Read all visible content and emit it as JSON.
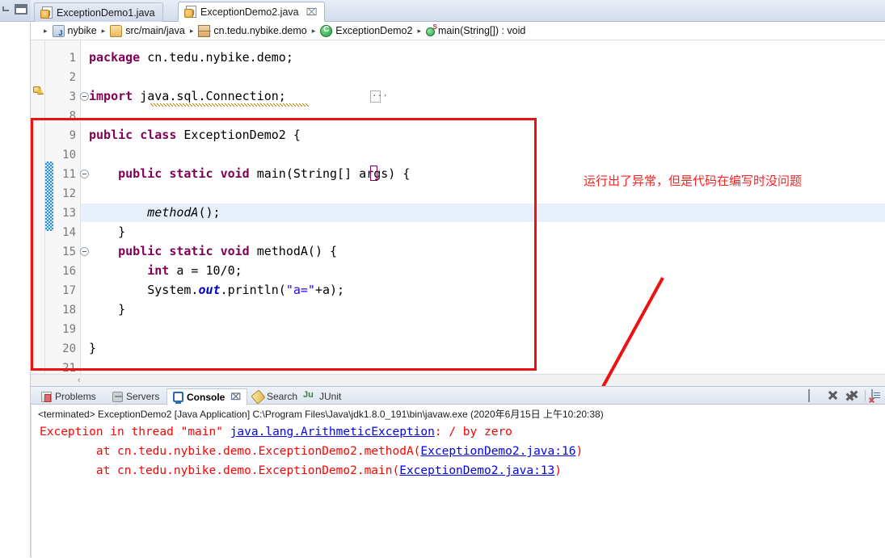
{
  "window": {
    "rail": {
      "minimize_icon": "minimize-icon",
      "restore_icon": "restore-icon"
    }
  },
  "editor": {
    "tabs": [
      {
        "label": "ExceptionDemo1.java",
        "active": false,
        "icon": "java-file-icon"
      },
      {
        "label": "ExceptionDemo2.java",
        "active": true,
        "icon": "java-file-icon",
        "close": "⌧"
      }
    ],
    "breadcrumb": [
      {
        "label": "nybike",
        "icon": "project-icon"
      },
      {
        "label": "src/main/java",
        "icon": "source-folder-icon"
      },
      {
        "label": "cn.tedu.nybike.demo",
        "icon": "package-icon"
      },
      {
        "label": "ExceptionDemo2",
        "icon": "class-icon"
      },
      {
        "label": "main(String[]) : void",
        "icon": "method-icon"
      }
    ],
    "separator": "▸",
    "lines": [
      {
        "num": "1",
        "code": "package cn.tedu.nybike.demo;"
      },
      {
        "num": "2",
        "code": ""
      },
      {
        "num": "3",
        "code": "import java.sql.Connection;"
      },
      {
        "num": "8",
        "code": ""
      },
      {
        "num": "9",
        "code": "public class ExceptionDemo2 {"
      },
      {
        "num": "10",
        "code": ""
      },
      {
        "num": "11",
        "code": "    public static void main(String[] args) {"
      },
      {
        "num": "12",
        "code": ""
      },
      {
        "num": "13",
        "code": "        methodA();"
      },
      {
        "num": "14",
        "code": "    }"
      },
      {
        "num": "15",
        "code": "    public static void methodA() {"
      },
      {
        "num": "16",
        "code": "        int a = 10/0;"
      },
      {
        "num": "17",
        "code": "        System.out.println(\"a=\"+a);"
      },
      {
        "num": "18",
        "code": "    }"
      },
      {
        "num": "19",
        "code": ""
      },
      {
        "num": "20",
        "code": "}"
      },
      {
        "num": "21",
        "code": ""
      }
    ],
    "hscroll_arrow": "‹"
  },
  "annotation": {
    "note": "运行出了异常，但是代码在编写时没问题",
    "note_color": "#ff2222",
    "box_color": "#ee1111",
    "arrow_color": "#ee1111"
  },
  "console": {
    "tabs": [
      {
        "label": "Problems",
        "icon": "problems-icon",
        "selected": false
      },
      {
        "label": "Servers",
        "icon": "servers-icon",
        "selected": false
      },
      {
        "label": "Console",
        "icon": "console-icon",
        "selected": true,
        "close": "⌧"
      },
      {
        "label": "Search",
        "icon": "search-icon",
        "selected": false
      },
      {
        "label": "JUnit",
        "icon": "junit-icon",
        "selected": false
      }
    ],
    "toolbar": [
      {
        "name": "stop-button",
        "icon": "stop-square-icon"
      },
      {
        "name": "terminate-button",
        "icon": "close-x-icon"
      },
      {
        "name": "remove-all-button",
        "icon": "close-all-xx-icon"
      },
      {
        "name": "clear-console-button",
        "icon": "clear-console-icon"
      }
    ],
    "terminated_line": "<terminated> ExceptionDemo2 [Java Application] C:\\Program Files\\Java\\jdk1.8.0_191\\bin\\javaw.exe (2020年6月15日 上午10:20:38)",
    "stacktrace": [
      {
        "pre": "Exception in thread \"main\" ",
        "link": "java.lang.ArithmeticException",
        "post": ": / by zero"
      },
      {
        "pre": "        at cn.tedu.nybike.demo.ExceptionDemo2.methodA(",
        "link": "ExceptionDemo2.java:16",
        "post": ")"
      },
      {
        "pre": "        at cn.tedu.nybike.demo.ExceptionDemo2.main(",
        "link": "ExceptionDemo2.java:13",
        "post": ")"
      }
    ],
    "error_color": "#ff0000",
    "link_color": "#0000ff"
  }
}
